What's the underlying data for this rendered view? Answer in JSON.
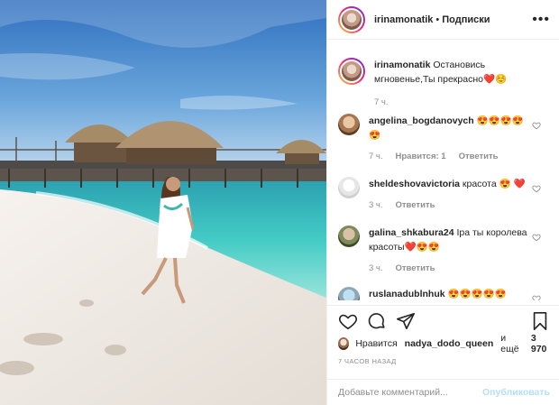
{
  "post": {
    "author": "irinamonatik",
    "separator": "•",
    "follow_label": "Подписки",
    "more_icon": "more-options-icon",
    "caption": "Остановись мгновенье,Ты прекрасно❤️☺️",
    "caption_time": "7 ч."
  },
  "comments": [
    {
      "user": "angelina_bogdanovych",
      "text": "😍😍😍😍😍",
      "time": "7 ч.",
      "likes": "Нравится: 1",
      "reply": "Ответить"
    },
    {
      "user": "sheldeshovavictoria",
      "text": "красота 😍 ❤️",
      "time": "3 ч.",
      "reply": "Ответить"
    },
    {
      "user": "galina_shkabura24",
      "text": "Ipa ты королева красоты❤️😍😍",
      "time": "3 ч.",
      "reply": "Ответить"
    },
    {
      "user": "ruslanadublnhuk",
      "text": "😍😍😍😍😍"
    }
  ],
  "actions": {
    "like_icon": "heart-icon",
    "comment_icon": "comment-icon",
    "share_icon": "share-icon",
    "save_icon": "bookmark-icon"
  },
  "likes": {
    "prefix": "Нравится",
    "user": "nadya_dodo_queen",
    "middle": "и ещё",
    "count": "3 970"
  },
  "timestamp": "7 ЧАСОВ НАЗАД",
  "add_comment": {
    "placeholder": "Добавьте комментарий...",
    "publish_label": "Опубликовать"
  },
  "colors": {
    "text": "#262626",
    "muted": "#8e8e8e",
    "publish_disabled": "#b2dffc",
    "sky": "#4a8bd0",
    "sea": "#3cc4c1",
    "sand": "#efeae4"
  }
}
